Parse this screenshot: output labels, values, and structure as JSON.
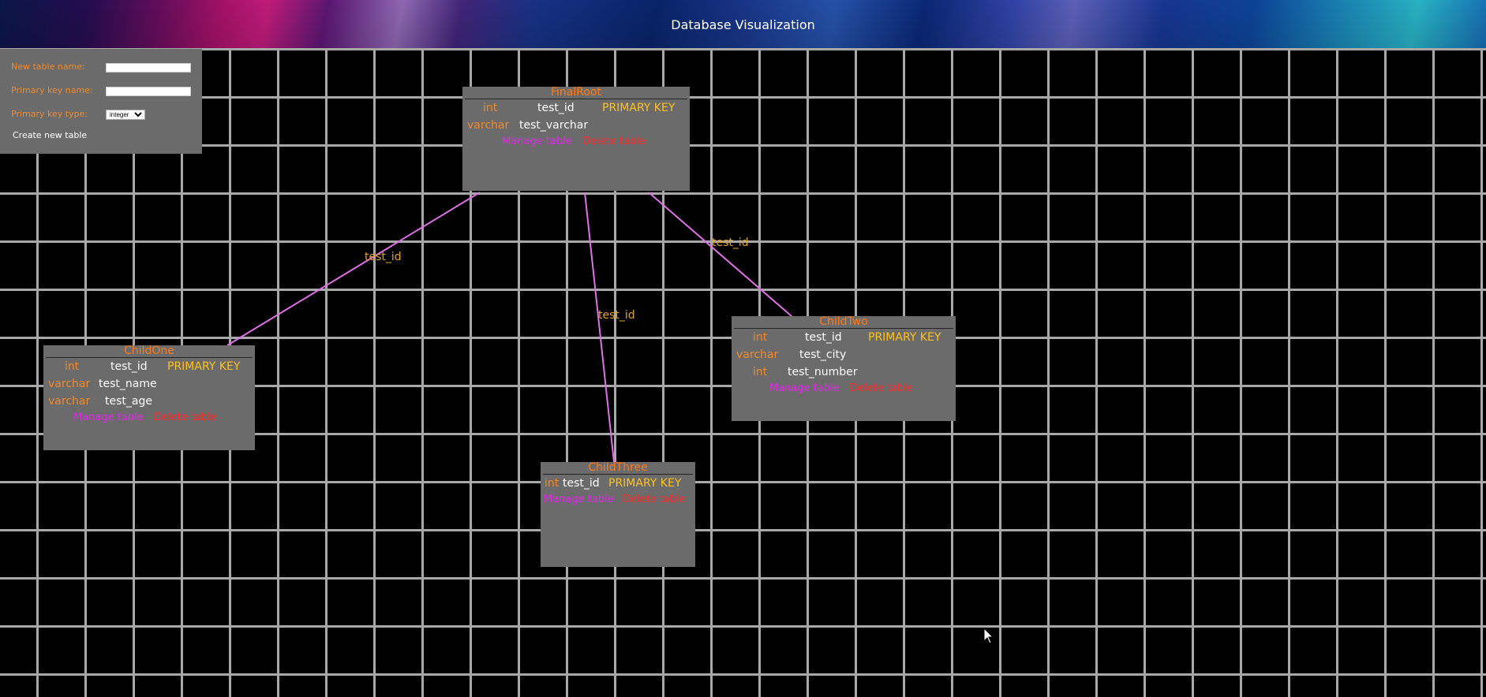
{
  "header": {
    "title": "Database Visualization"
  },
  "create_panel": {
    "table_name_label": "New table name:",
    "table_name_value": "",
    "pk_name_label": "Primary key name:",
    "pk_name_value": "",
    "pk_type_label": "Primary key type:",
    "pk_type_selected": "integer",
    "create_button": "Create new table"
  },
  "tables": [
    {
      "name": "FinalRoot",
      "columns": [
        {
          "type": "int",
          "name": "test_id",
          "constraint": "PRIMARY KEY"
        },
        {
          "type": "varchar",
          "name": "test_varchar",
          "constraint": ""
        }
      ],
      "manage": "Manage table",
      "delete": "Delete table"
    },
    {
      "name": "ChildOne",
      "columns": [
        {
          "type": "int",
          "name": "test_id",
          "constraint": "PRIMARY KEY"
        },
        {
          "type": "varchar",
          "name": "test_name",
          "constraint": ""
        },
        {
          "type": "varchar",
          "name": "test_age",
          "constraint": ""
        }
      ],
      "manage": "Manage table",
      "delete": "Delete table"
    },
    {
      "name": "ChildTwo",
      "columns": [
        {
          "type": "int",
          "name": "test_id",
          "constraint": "PRIMARY KEY"
        },
        {
          "type": "varchar",
          "name": "test_city",
          "constraint": ""
        },
        {
          "type": "int",
          "name": "test_number",
          "constraint": ""
        }
      ],
      "manage": "Manage table",
      "delete": "Delete table"
    },
    {
      "name": "ChildThree",
      "columns": [
        {
          "type": "int",
          "name": "test_id",
          "constraint": "PRIMARY KEY"
        }
      ],
      "manage": "Manage table",
      "delete": "Delete table"
    }
  ],
  "relations": [
    {
      "from": "FinalRoot",
      "to": "ChildOne",
      "label": "test_id"
    },
    {
      "from": "FinalRoot",
      "to": "ChildTwo",
      "label": "test_id"
    },
    {
      "from": "FinalRoot",
      "to": "ChildThree",
      "label": "test_id"
    }
  ],
  "colors": {
    "relation_line": "#e070e8",
    "relation_label": "#e6a21f",
    "table_bg": "#6b6b6b",
    "table_title": "#ff7a1a",
    "column_type": "#f08a2a",
    "primary_key": "#ffc21a",
    "manage_link": "#e028e8",
    "delete_link": "#ff2a2a"
  }
}
